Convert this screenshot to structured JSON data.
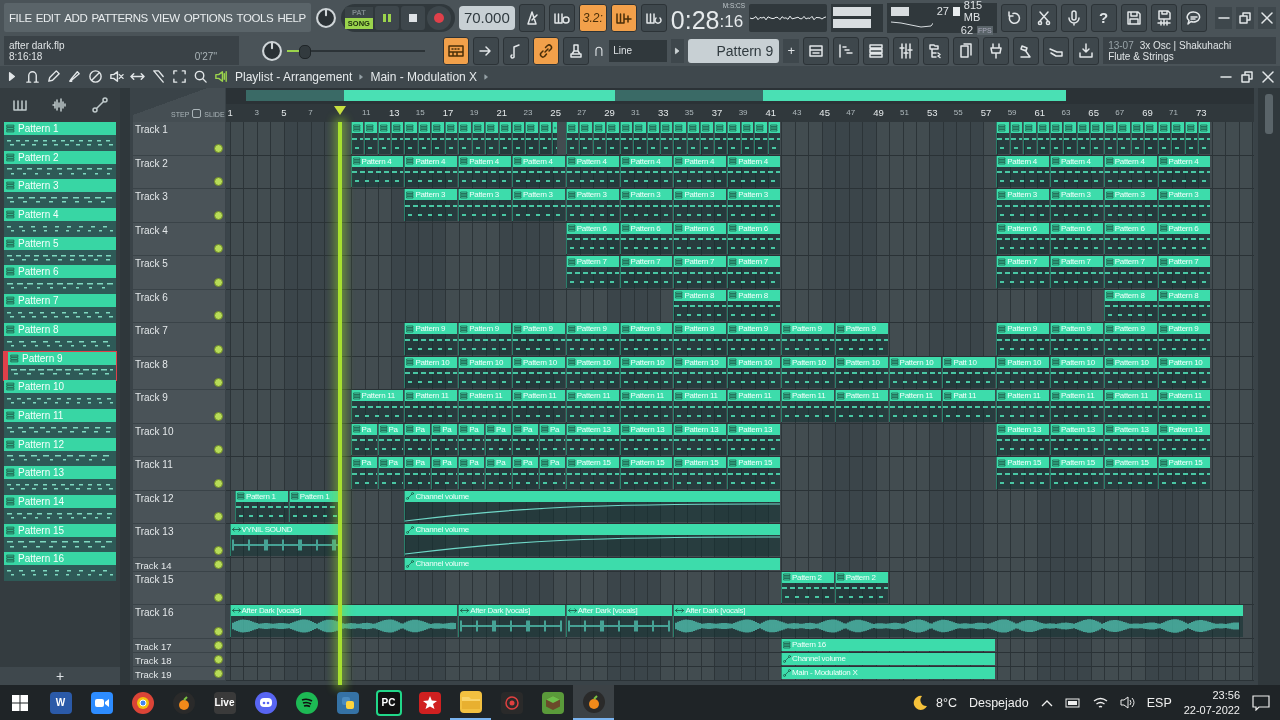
{
  "topbar": {
    "menu": [
      "FILE",
      "EDIT",
      "ADD",
      "PATTERNS",
      "VIEW",
      "OPTIONS",
      "TOOLS",
      "HELP"
    ],
    "modes": [
      {
        "label": "PAT",
        "selected": false
      },
      {
        "label": "SONG",
        "selected": true
      }
    ],
    "tempo": "70.000",
    "top_buttons": [
      {
        "kind": "metronome",
        "on": false
      },
      {
        "kind": "wait",
        "on": false
      },
      {
        "kind": "countdown",
        "label": "3.2:",
        "on": true
      },
      {
        "kind": "blend",
        "on": true
      },
      {
        "kind": "loop",
        "on": false
      }
    ],
    "time": {
      "main": "0:28",
      "small": ":16",
      "unit": "M:S:CS"
    },
    "monitor": {
      "voices": "27",
      "memory": "815 MB",
      "fps": "62",
      "fps_unit": "FPS"
    },
    "right_buttons": [
      {
        "kind": "undo"
      },
      {
        "kind": "cut"
      },
      {
        "kind": "mic"
      },
      {
        "kind": "help",
        "label": "?"
      },
      {
        "kind": "save"
      },
      {
        "kind": "export"
      },
      {
        "kind": "chat"
      }
    ],
    "window_controls": [
      {
        "kind": "minimize"
      },
      {
        "kind": "restore"
      },
      {
        "kind": "close"
      }
    ],
    "file": {
      "name": "after dark.flp",
      "length": "8:16:18",
      "elapsed": "0'27''"
    },
    "pitch": {
      "level": 0.12
    },
    "tool_buttons": [
      {
        "kind": "keyboard",
        "on": true
      },
      {
        "kind": "arrow",
        "on": false
      },
      {
        "kind": "note",
        "on": false
      },
      {
        "kind": "link",
        "on": true
      },
      {
        "kind": "stamp",
        "on": false
      }
    ],
    "snap": "Line",
    "pattern": "Pattern 9",
    "add": "+",
    "view_buttons": [
      {
        "kind": "playlist"
      },
      {
        "kind": "pianoroll"
      },
      {
        "kind": "channelrack"
      },
      {
        "kind": "mixer"
      },
      {
        "kind": "browser"
      },
      {
        "kind": "copy"
      },
      {
        "kind": "plug"
      },
      {
        "kind": "hammer"
      },
      {
        "kind": "hand"
      },
      {
        "kind": "download"
      }
    ],
    "hint": {
      "code": "13-07",
      "title": "3x Osc | Shakuhachi",
      "subtitle": "Flute & Strings"
    }
  },
  "playlist": {
    "tools": [
      {
        "kind": "play"
      },
      {
        "kind": "magnet"
      },
      {
        "kind": "pencil"
      },
      {
        "kind": "brush"
      },
      {
        "kind": "delete"
      },
      {
        "kind": "mute"
      },
      {
        "kind": "slip"
      },
      {
        "kind": "slice"
      },
      {
        "kind": "select"
      },
      {
        "kind": "zoom"
      },
      {
        "kind": "playback"
      }
    ],
    "title": "Playlist - Arrangement",
    "arrangement": "Main - Modulation X",
    "window_controls": [
      {
        "kind": "minimize"
      },
      {
        "kind": "restore"
      },
      {
        "kind": "close"
      }
    ],
    "picker_tabs": [
      {
        "kind": "comb"
      },
      {
        "kind": "wave"
      },
      {
        "kind": "automation"
      }
    ],
    "step": "STEP",
    "step_checked": false,
    "slide": "SLIDE",
    "ruler": [
      "1",
      "3",
      "5",
      "7",
      "11",
      "13",
      "15",
      "17",
      "19",
      "21",
      "23",
      "25",
      "27",
      "29",
      "31",
      "33",
      "35",
      "37",
      "39",
      "41",
      "43",
      "45",
      "47",
      "49",
      "51",
      "53",
      "55",
      "57",
      "59",
      "61",
      "63",
      "65",
      "67",
      "69",
      "71",
      "73"
    ],
    "playhead": {
      "level": 0.107
    },
    "patterns": [
      {
        "name": "Pattern 1",
        "selected": false
      },
      {
        "name": "Pattern 2",
        "selected": false
      },
      {
        "name": "Pattern 3",
        "selected": false
      },
      {
        "name": "Pattern 4",
        "selected": false
      },
      {
        "name": "Pattern 5",
        "selected": false
      },
      {
        "name": "Pattern 6",
        "selected": false
      },
      {
        "name": "Pattern 7",
        "selected": false
      },
      {
        "name": "Pattern 8",
        "selected": false
      },
      {
        "name": "Pattern 9",
        "selected": true
      },
      {
        "name": "Pattern 10",
        "selected": false
      },
      {
        "name": "Pattern 11",
        "selected": false
      },
      {
        "name": "Pattern 12",
        "selected": false
      },
      {
        "name": "Pattern 13",
        "selected": false
      },
      {
        "name": "Pattern 14",
        "selected": false
      },
      {
        "name": "Pattern 15",
        "selected": false
      },
      {
        "name": "Pattern 16",
        "selected": false
      }
    ],
    "add": "+",
    "tracks": [
      {
        "name": "Track 1",
        "clips": [
          {
            "kind": "pattern"
          },
          {
            "kind": "pattern"
          },
          {
            "kind": "pattern"
          }
        ]
      },
      {
        "name": "Track 2",
        "clips": [
          {
            "kind": "pattern",
            "label": "Pattern 4"
          },
          {
            "kind": "pattern",
            "label": "Pattern 4"
          },
          {
            "kind": "pattern",
            "label": "Pattern 4"
          },
          {
            "kind": "pattern",
            "label": "Pattern 4"
          },
          {
            "kind": "pattern",
            "label": "Pattern 4"
          },
          {
            "kind": "pattern",
            "label": "Pattern 4"
          },
          {
            "kind": "pattern",
            "label": "Pattern 4"
          },
          {
            "kind": "pattern",
            "label": "Pattern 4"
          },
          {
            "kind": "pattern",
            "label": "Pattern 4"
          },
          {
            "kind": "pattern",
            "label": "Pattern 4"
          },
          {
            "kind": "pattern",
            "label": "Pattern 4"
          },
          {
            "kind": "pattern",
            "label": "Pattern 4"
          }
        ]
      },
      {
        "name": "Track 3",
        "clips": [
          {
            "kind": "pattern",
            "label": "Pattern 3"
          },
          {
            "kind": "pattern",
            "label": "Pattern 3"
          },
          {
            "kind": "pattern",
            "label": "Pattern 3"
          },
          {
            "kind": "pattern",
            "label": "Pattern 3"
          },
          {
            "kind": "pattern",
            "label": "Pattern 3"
          },
          {
            "kind": "pattern",
            "label": "Pattern 3"
          },
          {
            "kind": "pattern",
            "label": "Pattern 3"
          },
          {
            "kind": "pattern",
            "label": "Pattern 3"
          },
          {
            "kind": "pattern",
            "label": "Pattern 3"
          },
          {
            "kind": "pattern",
            "label": "Pattern 3"
          },
          {
            "kind": "pattern",
            "label": "Pattern 3"
          }
        ]
      },
      {
        "name": "Track 4",
        "clips": [
          {
            "kind": "pattern",
            "label": "Pattern 6"
          },
          {
            "kind": "pattern",
            "label": "Pattern 6"
          },
          {
            "kind": "pattern",
            "label": "Pattern 6"
          },
          {
            "kind": "pattern",
            "label": "Pattern 6"
          },
          {
            "kind": "pattern",
            "label": "Pattern 6"
          },
          {
            "kind": "pattern",
            "label": "Pattern 6"
          },
          {
            "kind": "pattern",
            "label": "Pattern 6"
          },
          {
            "kind": "pattern",
            "label": "Pattern 6"
          }
        ]
      },
      {
        "name": "Track 5",
        "clips": [
          {
            "kind": "pattern",
            "label": "Pattern 7"
          },
          {
            "kind": "pattern",
            "label": "Pattern 7"
          },
          {
            "kind": "pattern",
            "label": "Pattern 7"
          },
          {
            "kind": "pattern",
            "label": "Pattern 7"
          },
          {
            "kind": "pattern",
            "label": "Pattern 7"
          },
          {
            "kind": "pattern",
            "label": "Pattern 7"
          },
          {
            "kind": "pattern",
            "label": "Pattern 7"
          },
          {
            "kind": "pattern",
            "label": "Pattern 7"
          }
        ]
      },
      {
        "name": "Track 6",
        "clips": [
          {
            "kind": "pattern",
            "label": "Pattern 8"
          },
          {
            "kind": "pattern",
            "label": "Pattern 8"
          },
          {
            "kind": "pattern",
            "label": "Pattern 8"
          },
          {
            "kind": "pattern",
            "label": "Pattern 8"
          }
        ]
      },
      {
        "name": "Track 7",
        "clips": [
          {
            "kind": "pattern",
            "label": "Pattern 9"
          },
          {
            "kind": "pattern",
            "label": "Pattern 9"
          },
          {
            "kind": "pattern",
            "label": "Pattern 9"
          },
          {
            "kind": "pattern",
            "label": "Pattern 9"
          },
          {
            "kind": "pattern",
            "label": "Pattern 9"
          },
          {
            "kind": "pattern",
            "label": "Pattern 9"
          },
          {
            "kind": "pattern",
            "label": "Pattern 9"
          },
          {
            "kind": "pattern",
            "label": "Pattern 9"
          },
          {
            "kind": "pattern",
            "label": "Pattern 9"
          },
          {
            "kind": "pattern",
            "label": "Pattern 9"
          },
          {
            "kind": "pattern",
            "label": "Pattern 9"
          },
          {
            "kind": "pattern",
            "label": "Pattern 9"
          },
          {
            "kind": "pattern",
            "label": "Pattern 9"
          }
        ]
      },
      {
        "name": "Track 8",
        "clips": [
          {
            "kind": "pattern",
            "label": "Pattern 10"
          },
          {
            "kind": "pattern",
            "label": "Pattern 10"
          },
          {
            "kind": "pattern",
            "label": "Pattern 10"
          },
          {
            "kind": "pattern",
            "label": "Pattern 10"
          },
          {
            "kind": "pattern",
            "label": "Pattern 10"
          },
          {
            "kind": "pattern",
            "label": "Pattern 10"
          },
          {
            "kind": "pattern",
            "label": "Pattern 10"
          },
          {
            "kind": "pattern",
            "label": "Pattern 10"
          },
          {
            "kind": "pattern",
            "label": "Pattern 10"
          },
          {
            "kind": "pattern",
            "label": "Pattern 10"
          },
          {
            "kind": "pattern",
            "label": "Patt 10"
          },
          {
            "kind": "pattern",
            "label": "Pattern 10"
          },
          {
            "kind": "pattern",
            "label": "Pattern 10"
          },
          {
            "kind": "pattern",
            "label": "Pattern 10"
          },
          {
            "kind": "pattern",
            "label": "Pattern 10"
          }
        ]
      },
      {
        "name": "Track 9",
        "clips": [
          {
            "kind": "pattern",
            "label": "Pattern 11"
          },
          {
            "kind": "pattern",
            "label": "Pattern 11"
          },
          {
            "kind": "pattern",
            "label": "Pattern 11"
          },
          {
            "kind": "pattern",
            "label": "Pattern 11"
          },
          {
            "kind": "pattern",
            "label": "Pattern 11"
          },
          {
            "kind": "pattern",
            "label": "Pattern 11"
          },
          {
            "kind": "pattern",
            "label": "Pattern 11"
          },
          {
            "kind": "pattern",
            "label": "Pattern 11"
          },
          {
            "kind": "pattern",
            "label": "Pattern 11"
          },
          {
            "kind": "pattern",
            "label": "Pattern 11"
          },
          {
            "kind": "pattern",
            "label": "Pattern 11"
          },
          {
            "kind": "pattern",
            "label": "Patt 11"
          },
          {
            "kind": "pattern",
            "label": "Pattern 11"
          },
          {
            "kind": "pattern",
            "label": "Pattern 11"
          },
          {
            "kind": "pattern",
            "label": "Pattern 11"
          },
          {
            "kind": "pattern",
            "label": "Pattern 11"
          }
        ]
      },
      {
        "name": "Track 10",
        "clips": [
          {
            "kind": "pattern",
            "label": "Pa"
          },
          {
            "kind": "pattern",
            "label": "Pa"
          },
          {
            "kind": "pattern",
            "label": "Pa"
          },
          {
            "kind": "pattern",
            "label": "Pa"
          },
          {
            "kind": "pattern",
            "label": "Pa"
          },
          {
            "kind": "pattern",
            "label": "Pa"
          },
          {
            "kind": "pattern",
            "label": "Pa"
          },
          {
            "kind": "pattern",
            "label": "Pa"
          },
          {
            "kind": "pattern",
            "label": "Pattern 13"
          },
          {
            "kind": "pattern",
            "label": "Pattern 13"
          },
          {
            "kind": "pattern",
            "label": "Pattern 13"
          },
          {
            "kind": "pattern",
            "label": "Pattern 13"
          },
          {
            "kind": "pattern",
            "label": "Pattern 13"
          },
          {
            "kind": "pattern",
            "label": "Pattern 13"
          },
          {
            "kind": "pattern",
            "label": "Pattern 13"
          },
          {
            "kind": "pattern",
            "label": "Pattern 13"
          }
        ]
      },
      {
        "name": "Track 11",
        "clips": [
          {
            "kind": "pattern",
            "label": "Pa"
          },
          {
            "kind": "pattern",
            "label": "Pa"
          },
          {
            "kind": "pattern",
            "label": "Pa"
          },
          {
            "kind": "pattern",
            "label": "Pa"
          },
          {
            "kind": "pattern",
            "label": "Pa"
          },
          {
            "kind": "pattern",
            "label": "Pa"
          },
          {
            "kind": "pattern",
            "label": "Pa"
          },
          {
            "kind": "pattern",
            "label": "Pa"
          },
          {
            "kind": "pattern",
            "label": "Pattern 15"
          },
          {
            "kind": "pattern",
            "label": "Pattern 15"
          },
          {
            "kind": "pattern",
            "label": "Pattern 15"
          },
          {
            "kind": "pattern",
            "label": "Pattern 15"
          },
          {
            "kind": "pattern",
            "label": "Pattern 15"
          },
          {
            "kind": "pattern",
            "label": "Pattern 15"
          },
          {
            "kind": "pattern",
            "label": "Pattern 15"
          },
          {
            "kind": "pattern",
            "label": "Pattern 15"
          }
        ]
      },
      {
        "name": "Track 12",
        "clips": [
          {
            "kind": "pattern",
            "label": "Pattern 1"
          },
          {
            "kind": "pattern",
            "label": "Pattern 1"
          },
          {
            "kind": "automation",
            "label": "Channel volume"
          }
        ]
      },
      {
        "name": "Track 13",
        "clips": [
          {
            "kind": "audio",
            "label": "VYNIL SOUND"
          },
          {
            "kind": "automation",
            "label": "Channel volume"
          }
        ]
      },
      {
        "name": "Track 14",
        "clips": [
          {
            "kind": "automation",
            "label": "Channel volume"
          }
        ]
      },
      {
        "name": "Track 15",
        "clips": [
          {
            "kind": "pattern",
            "label": "Pattern 2"
          },
          {
            "kind": "pattern",
            "label": "Pattern 2"
          }
        ]
      },
      {
        "name": "Track 16",
        "clips": [
          {
            "kind": "audio",
            "label": "After Dark [vocals]"
          },
          {
            "kind": "audio",
            "label": "After Dark [vocals]"
          },
          {
            "kind": "audio",
            "label": "After Dark [vocals]"
          },
          {
            "kind": "audio",
            "label": "After Dark [vocals]"
          }
        ]
      },
      {
        "name": "Track 17",
        "clips": [
          {
            "kind": "pattern",
            "label": "Pattern 16"
          }
        ]
      },
      {
        "name": "Track 18",
        "clips": [
          {
            "kind": "automation",
            "label": "Channel volume"
          }
        ]
      },
      {
        "name": "Track 19",
        "clips": [
          {
            "kind": "automation",
            "label": "Main - Modulation X"
          }
        ]
      }
    ]
  },
  "taskbar": {
    "apps": [
      {
        "kind": "word",
        "label": "W",
        "selected": false,
        "running": false
      },
      {
        "kind": "camera",
        "selected": false,
        "running": false
      },
      {
        "kind": "chrome",
        "selected": false,
        "running": false
      },
      {
        "kind": "fruit",
        "selected": false,
        "running": false
      },
      {
        "kind": "live",
        "label": "Live",
        "selected": false,
        "running": false
      },
      {
        "kind": "discord",
        "selected": false,
        "running": false
      },
      {
        "kind": "spotify",
        "selected": false,
        "running": false
      },
      {
        "kind": "python",
        "selected": false,
        "running": false
      },
      {
        "kind": "pycharm",
        "label": "PC",
        "selected": false,
        "running": false
      },
      {
        "kind": "gear",
        "selected": false,
        "running": false
      },
      {
        "kind": "folder",
        "selected": false,
        "running": true
      },
      {
        "kind": "recorder",
        "selected": false,
        "running": false
      },
      {
        "kind": "cube",
        "selected": false,
        "running": false
      },
      {
        "kind": "fruit",
        "selected": true,
        "running": true
      }
    ],
    "weather": {
      "temp": "8°C",
      "text": "Despejado"
    },
    "language": "ESP",
    "clock": {
      "time": "23:56",
      "date": "22-07-2022"
    }
  }
}
